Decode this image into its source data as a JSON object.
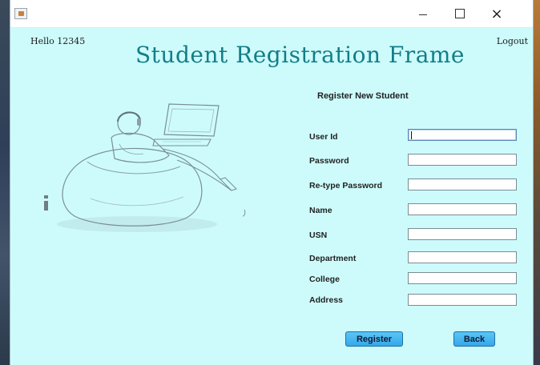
{
  "window": {
    "minimize_icon": "minimize-icon",
    "maximize_icon": "maximize-icon",
    "close_icon": "close-icon",
    "close_glyph": "×"
  },
  "header": {
    "greeting": "Hello 12345",
    "logout_label": "Logout",
    "title": "Student Registration Frame"
  },
  "form": {
    "heading": "Register New Student",
    "fields": [
      {
        "label": "User Id",
        "value": ""
      },
      {
        "label": "Password",
        "value": ""
      },
      {
        "label": "Re-type Password",
        "value": ""
      },
      {
        "label": "Name",
        "value": ""
      },
      {
        "label": "USN",
        "value": ""
      },
      {
        "label": "Department",
        "value": ""
      },
      {
        "label": "College",
        "value": ""
      },
      {
        "label": "Address",
        "value": ""
      }
    ],
    "register_label": "Register",
    "back_label": "Back"
  },
  "colors": {
    "background": "#cdfbfb",
    "title": "#147d88",
    "button": "#35a8e9"
  }
}
